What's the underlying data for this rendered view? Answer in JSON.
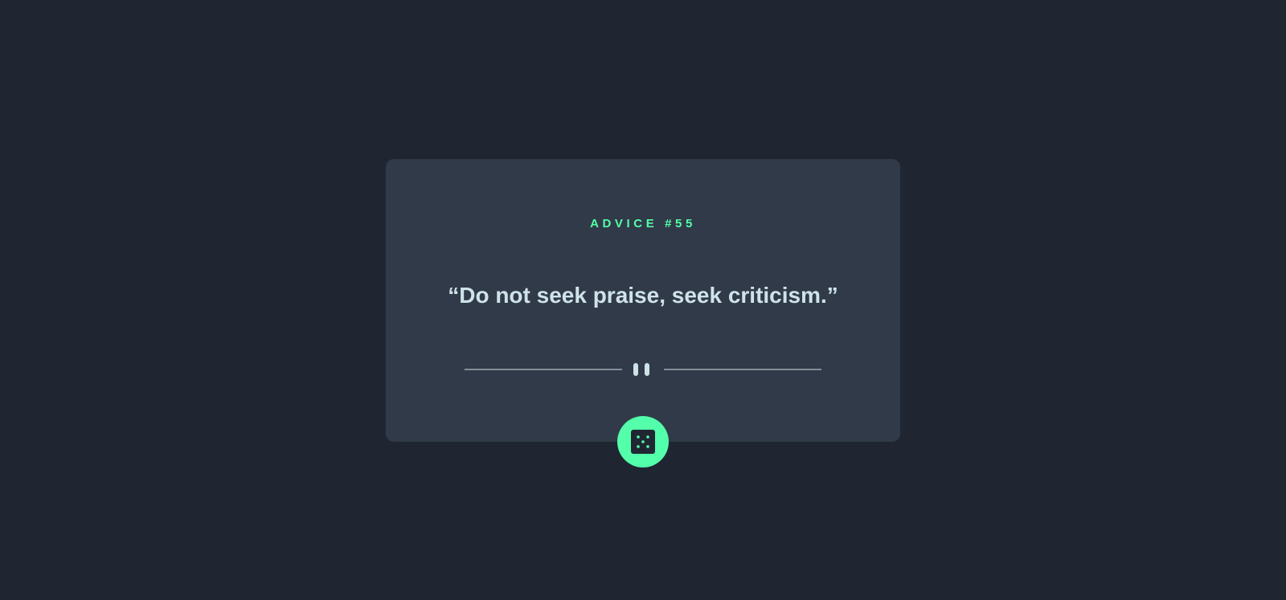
{
  "advice": {
    "id_label": "ADVICE #55",
    "quote": "“Do not seek praise, seek criticism.”"
  },
  "icons": {
    "divider": "pause-divider-icon",
    "generate": "dice-icon"
  },
  "colors": {
    "background": "#1f2632",
    "card": "#313a48",
    "accent": "#52ffa8",
    "quote_text": "#cee3e9",
    "divider": "#4f5d74",
    "button": "#53ffaa",
    "dice": "#202733"
  }
}
